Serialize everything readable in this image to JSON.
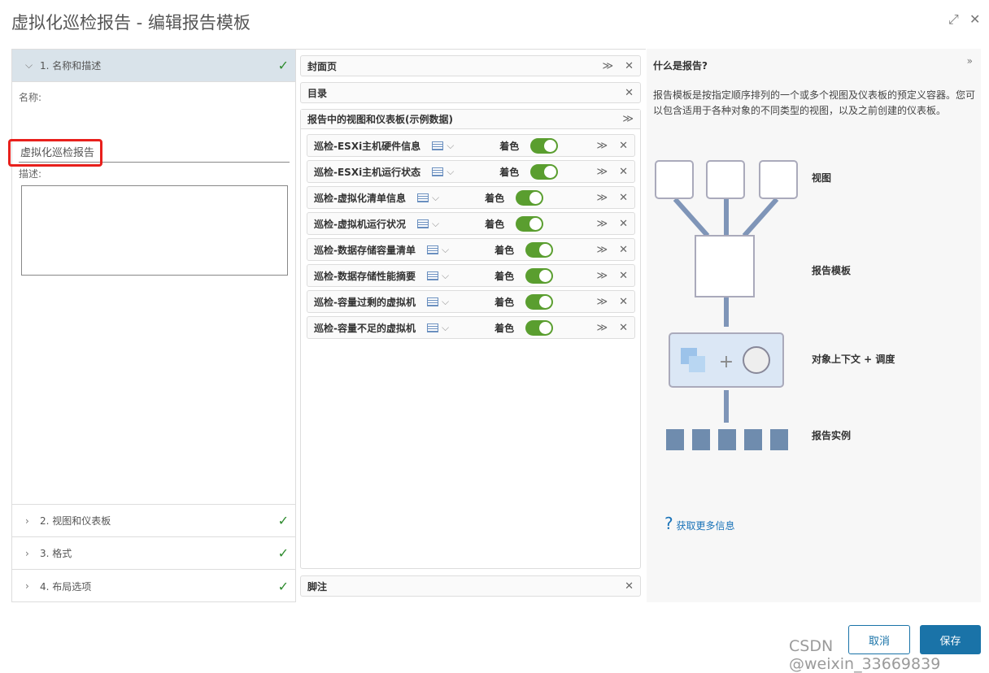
{
  "title": "虚拟化巡检报告 - 编辑报告模板",
  "steps": [
    {
      "label": "1. 名称和描述"
    },
    {
      "label": "2. 视图和仪表板"
    },
    {
      "label": "3. 格式"
    },
    {
      "label": "4. 布局选项"
    }
  ],
  "form": {
    "name_label": "名称:",
    "name_value": "虚拟化巡检报告",
    "desc_label": "描述:",
    "desc_value": ""
  },
  "middle": {
    "cover": "封面页",
    "toc": "目录",
    "views_header": "报告中的视图和仪表板(示例数据)",
    "footer": "脚注",
    "color_label": "着色",
    "rows": [
      {
        "name": "巡检-ESXi主机硬件信息",
        "colored": true
      },
      {
        "name": "巡检-ESXi主机运行状态",
        "colored": true
      },
      {
        "name": "巡检-虚拟化清单信息",
        "colored": true
      },
      {
        "name": "巡检-虚拟机运行状况",
        "colored": true
      },
      {
        "name": "巡检-数据存储容量清单",
        "colored": true
      },
      {
        "name": "巡检-数据存储性能摘要",
        "colored": true
      },
      {
        "name": "巡检-容量过剩的虚拟机",
        "colored": true
      },
      {
        "name": "巡检-容量不足的虚拟机",
        "colored": true
      }
    ]
  },
  "help": {
    "title": "什么是报告?",
    "text": "报告模板是按指定顺序排列的一个或多个视图及仪表板的预定义容器。您可以包含适用于各种对象的不同类型的视图，以及之前创建的仪表板。",
    "diagram": {
      "views": "视图",
      "template": "报告模板",
      "context": "对象上下文 + 调度",
      "instances": "报告实例"
    },
    "more": "获取更多信息"
  },
  "buttons": {
    "cancel": "取消",
    "save": "保存"
  },
  "watermark": "CSDN @weixin_33669839",
  "colors": {
    "accent": "#1a73a8",
    "toggle": "#5a9e2f",
    "check": "#2e8b2e",
    "highlight": "#e8201c"
  }
}
